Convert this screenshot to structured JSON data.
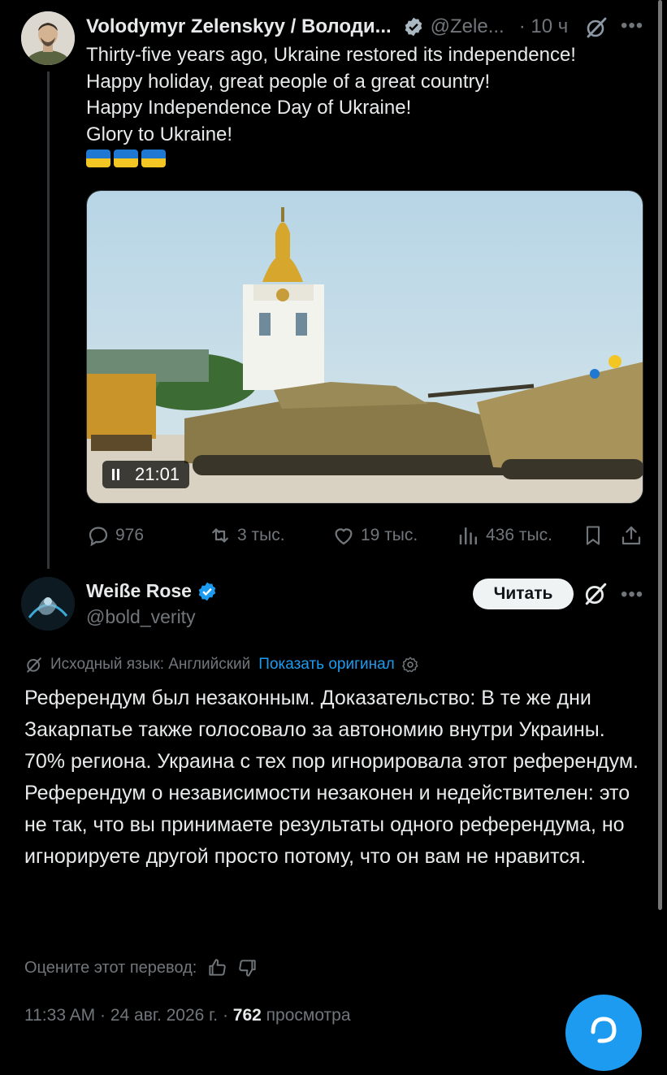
{
  "tweet1": {
    "author_name": "Volodymyr Zelenskyy / Володи...",
    "handle": "@Zele...",
    "time": "· 10 ч",
    "text": "Thirty-five years ago, Ukraine restored its independence!\nHappy holiday, great people of a great country!\nHappy Independence Day of Ukraine!\nGlory to Ukraine!",
    "flag_emoji": "🇺🇦🇺🇦🇺🇦",
    "video_duration": "21:01",
    "stats": {
      "replies": "976",
      "reposts": "3 тыс.",
      "likes": "19 тыс.",
      "views": "436 тыс."
    }
  },
  "tweet2": {
    "author_name": "Weiße Rose",
    "handle": "@bold_verity",
    "follow_label": "Читать",
    "translation_note": "Исходный язык: Английский",
    "show_original": "Показать оригинал",
    "text": "Референдум был незаконным. Доказательство: В те же дни Закарпатье также голосовало за автономию внутри Украины. 70% региона. Украина с тех пор игнорировала этот референдум. Референдум о независимости незаконен и недействителен: это не так, что вы принимаете результаты одного референдума, но игнорируете другой просто потому, что он вам не нравится.",
    "rate_prompt": "Оцените этот перевод:",
    "timestamp": "11:33 AM · 24 авг. 2026 г. · ",
    "views_count": "762",
    "views_label": " просмотра"
  },
  "colors": {
    "background": "#000000",
    "text": "#e7e9ea",
    "muted": "#71767b",
    "accent": "#1d9bf0",
    "flag_blue": "#1f78d1",
    "flag_yellow": "#f3c623"
  },
  "icons": [
    "verified-badge-icon",
    "grok-icon",
    "more-icon",
    "reply-icon",
    "repost-icon",
    "like-icon",
    "views-icon",
    "bookmark-icon",
    "share-icon",
    "translate-icon",
    "settings-icon",
    "thumbs-up-icon",
    "thumbs-down-icon",
    "compose-icon",
    "pause-icon"
  ]
}
